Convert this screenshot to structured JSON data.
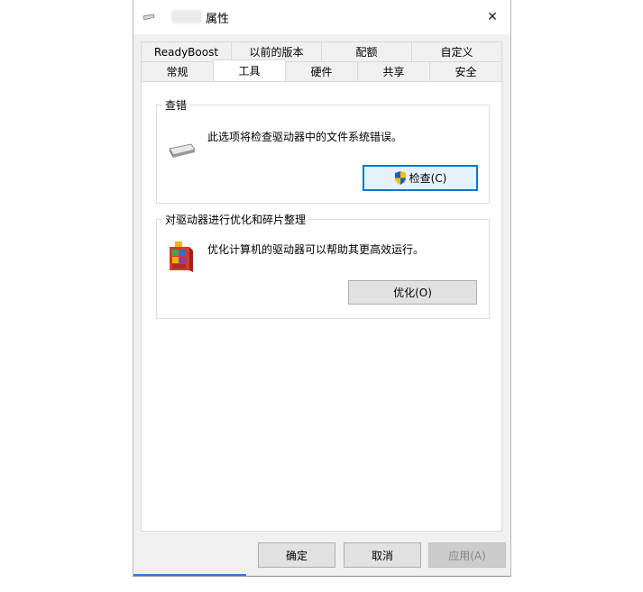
{
  "window": {
    "title": "属性",
    "close_glyph": "✕"
  },
  "tabs": {
    "row1": [
      "ReadyBoost",
      "以前的版本",
      "配额",
      "自定义"
    ],
    "row2": [
      "常规",
      "工具",
      "硬件",
      "共享",
      "安全"
    ],
    "active": "工具"
  },
  "error_check": {
    "title": "查错",
    "description": "此选项将检查驱动器中的文件系统错误。",
    "button": "检查(C)"
  },
  "optimize": {
    "title": "对驱动器进行优化和碎片整理",
    "description": "优化计算机的驱动器可以帮助其更高效运行。",
    "button": "优化(O)"
  },
  "footer": {
    "ok": "确定",
    "cancel": "取消",
    "apply": "应用(A)"
  },
  "icons": [
    "drive-icon",
    "shield-icon",
    "defrag-icon",
    "close-icon"
  ],
  "colors": {
    "focus_border": "#0078d7",
    "accent_line": "#3c78c8"
  }
}
